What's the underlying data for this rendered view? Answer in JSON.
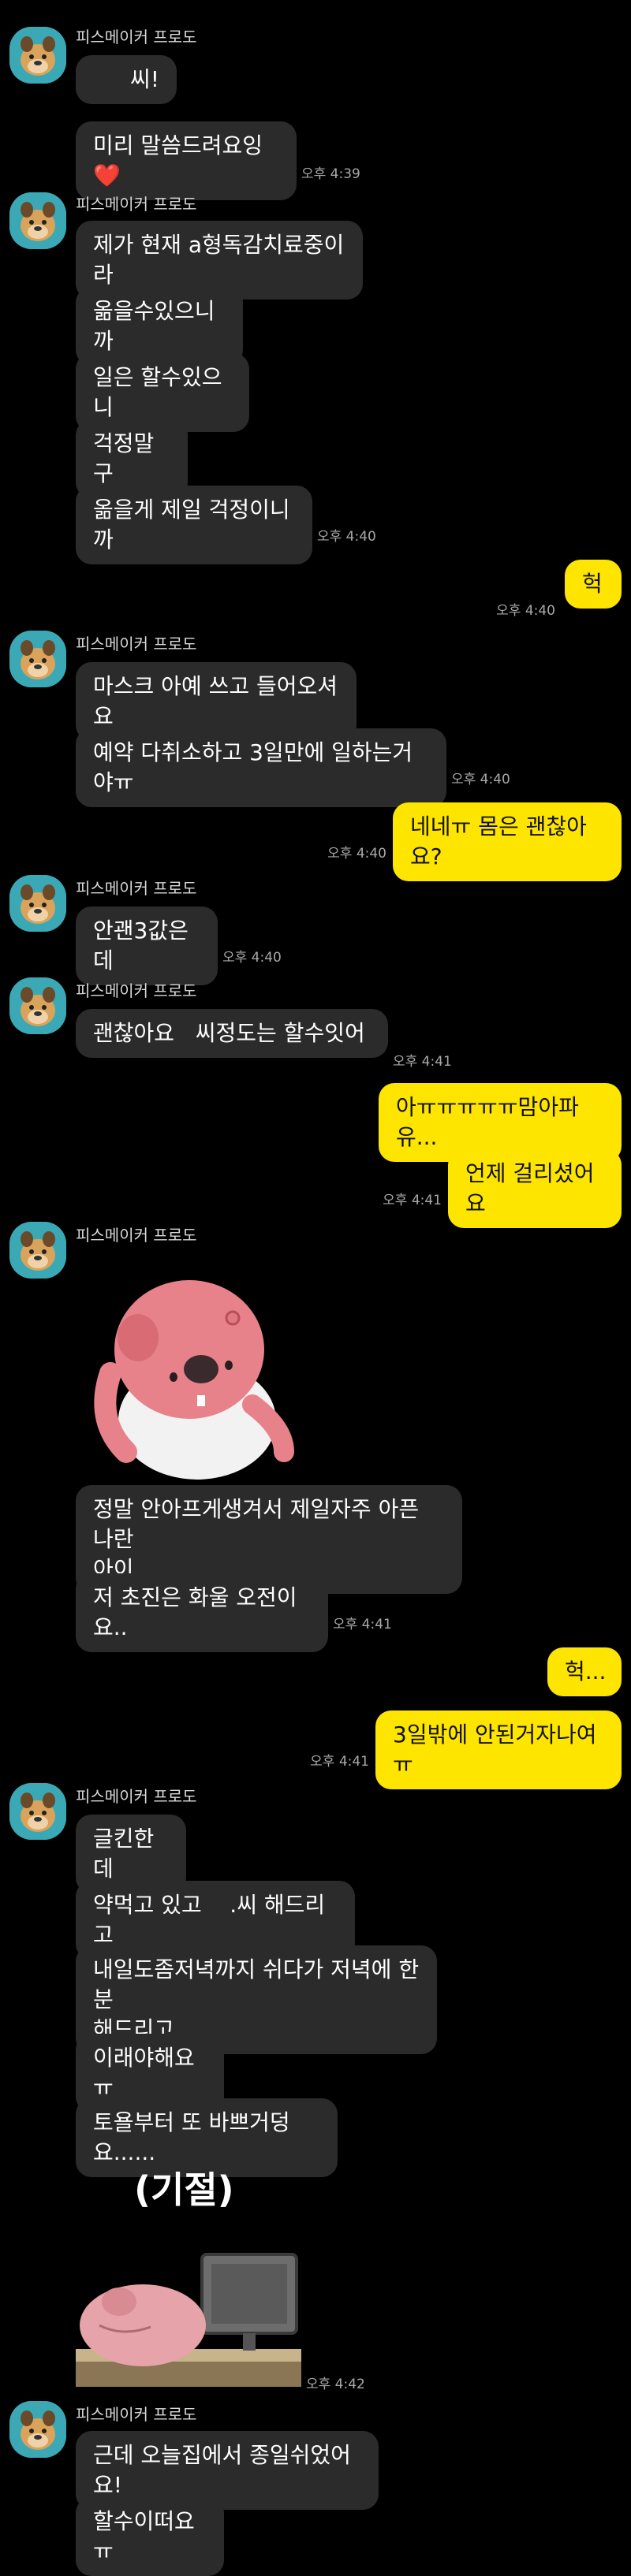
{
  "sender_name": "피스메이커 프로도",
  "blocks": [
    {
      "messages": [
        "씨!",
        "미리 말씀드려요잉❤️"
      ],
      "time": "오후 4:39"
    },
    {
      "messages": [
        "제가 현재 a형독감치료중이라",
        "옮을수있으니까",
        "일은 할수있으니",
        "걱정말구",
        "옮을게 제일 걱정이니까"
      ],
      "time": "오후 4:40"
    },
    {
      "sent": [
        "헉"
      ],
      "time": "오후 4:40"
    },
    {
      "messages": [
        "마스크 아예 쓰고 들어오셔요",
        "예약 다취소하고 3일만에 일하는거야ㅠ"
      ],
      "time": "오후 4:40"
    },
    {
      "sent": [
        "네네ㅠ 몸은 괜찮아요?"
      ],
      "time": "오후 4:40"
    },
    {
      "messages": [
        "안괜3값은데"
      ],
      "time": "오후 4:40"
    },
    {
      "messages": [
        "괜찮아요   씨정도는 할수잇어"
      ],
      "time": "오후 4:41"
    },
    {
      "sent": [
        "아ㅠㅠㅠㅠㅠ맘아파유...",
        "언제 걸리셨어요"
      ],
      "time": "오후 4:41"
    },
    {
      "sticker": "pink-beaver-sticker",
      "messages": [
        "정말 안아프게생겨서 제일자주 아픈 나란\n아이..",
        "저 초진은 화울 오전이요.."
      ],
      "time": "오후 4:41"
    },
    {
      "sent": [
        "헉...",
        "3일밖에 안된거자나여ㅠ"
      ],
      "time": "오후 4:41"
    },
    {
      "messages": [
        "글킨한데",
        "약먹고 있고    .씨 해드리고",
        "내일도좀저녁까지 쉬다가 저녁에 한분\n해드리고",
        "이래야해요ㅠ",
        "토욜부터 또 바쁘거덩요......"
      ],
      "sticker": "fainting-beaver-sticker",
      "sticker_caption": "(기절)",
      "time": "오후 4:42"
    },
    {
      "messages": [
        "근데 오늘집에서 종일쉬었어요!",
        "할수이떠요ㅠ"
      ]
    }
  ],
  "colors": {
    "sent_bubble": "#fee500",
    "recv_bubble": "#2b2b2b",
    "avatar_bg": "#3aa9b5"
  }
}
